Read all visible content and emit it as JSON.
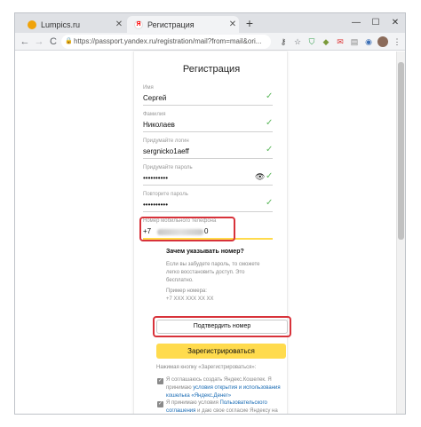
{
  "browser": {
    "tabs": [
      {
        "title": "Lumpics.ru",
        "favicon_color": "#f0a30a",
        "active": false
      },
      {
        "title": "Регистрация",
        "favicon_color": "#ff0000",
        "active": true
      }
    ],
    "new_tab": "+",
    "window_controls": {
      "minimize": "—",
      "maximize": "☐",
      "close": "✕"
    },
    "nav": {
      "back": "←",
      "forward": "→",
      "reload": "C"
    },
    "url": "https://passport.yandex.ru/registration/mail?from=mail&ori..."
  },
  "page": {
    "heading": "Регистрация",
    "fields": [
      {
        "label": "Имя",
        "value": "Сергей",
        "valid": true
      },
      {
        "label": "Фамилия",
        "value": "Николаев",
        "valid": true
      },
      {
        "label": "Придумайте логин",
        "value": "sergnicko1aeff",
        "valid": true
      },
      {
        "label": "Придумайте пароль",
        "value": "••••••••••",
        "valid": true
      },
      {
        "label": "Повторите пароль",
        "value": "••••••••••",
        "valid": true
      }
    ],
    "phone": {
      "label": "Номер мобильного телефона",
      "prefix": "+7",
      "suffix": "0"
    },
    "why_title": "Зачем указывать номер?",
    "why_text": "Если вы забудете пароль, то сможете легко восстановить доступ. Это бесплатно.",
    "example_label": "Пример номера:",
    "example_value": "+7 XXX XXX XX XX",
    "confirm_button": "Подтвердить номер",
    "register_button": "Зарегистрироваться",
    "note": "Нажимая кнопку «Зарегистрироваться»:",
    "agreement1_text": "Я соглашаюсь создать Яндекс.Кошелек. Я принимаю",
    "agreement1_link": "условия открытия и использования кошелька «Яндекс.Денег»",
    "agreement2_text": "Я принимаю условия",
    "agreement2_link": "Пользовательского соглашения",
    "agreement2_tail": "и даю свое согласие Яндексу на",
    "colors": {
      "accent_yellow": "#ffdb4d",
      "highlight_red": "#d8323a",
      "check_green": "#5db85c",
      "link_blue": "#1a6cb5"
    }
  }
}
